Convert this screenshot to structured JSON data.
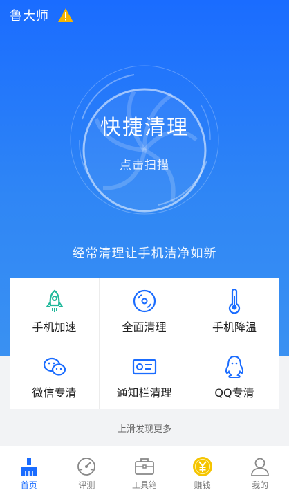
{
  "header": {
    "app_title": "鲁大师",
    "warning_icon": "warning-icon"
  },
  "hero": {
    "main_button": "快捷清理",
    "sub_button": "点击扫描",
    "slogan": "经常清理让手机洁净如新"
  },
  "features": [
    {
      "label": "手机加速",
      "icon": "rocket-icon"
    },
    {
      "label": "全面清理",
      "icon": "disc-clean-icon"
    },
    {
      "label": "手机降温",
      "icon": "thermometer-icon"
    },
    {
      "label": "微信专清",
      "icon": "wechat-icon"
    },
    {
      "label": "通知栏清理",
      "icon": "notification-card-icon"
    },
    {
      "label": "QQ专清",
      "icon": "qq-penguin-icon"
    }
  ],
  "more_hint": "上滑发现更多",
  "tabs": [
    {
      "label": "首页",
      "icon": "broom-home-icon",
      "active": true
    },
    {
      "label": "评测",
      "icon": "gauge-icon",
      "active": false
    },
    {
      "label": "工具箱",
      "icon": "toolbox-icon",
      "active": false
    },
    {
      "label": "赚钱",
      "icon": "yuan-coin-icon",
      "active": false
    },
    {
      "label": "我的",
      "icon": "user-icon",
      "active": false
    }
  ],
  "colors": {
    "primary": "#1a6cff",
    "teal": "#1fb89a",
    "coin": "#f5c400",
    "warning": "#f7b500"
  }
}
